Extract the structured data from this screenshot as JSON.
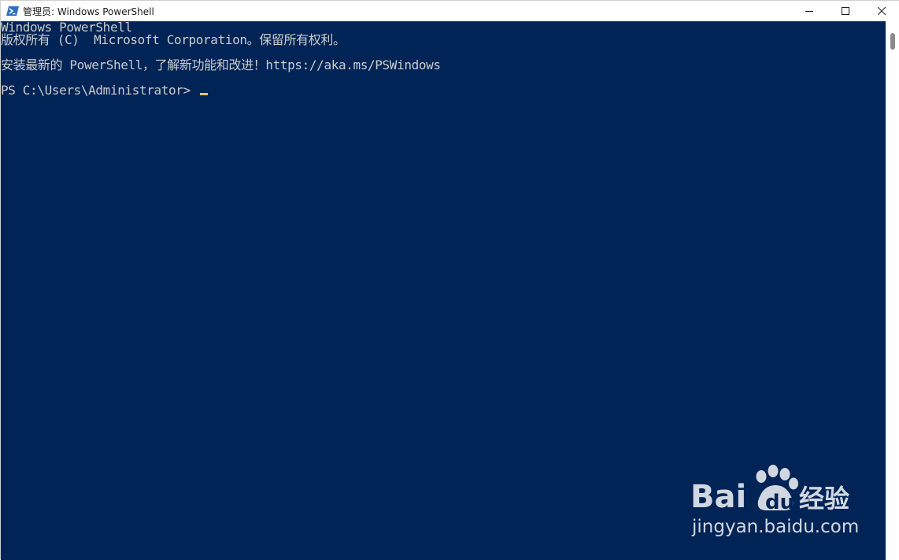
{
  "window": {
    "title": "管理员: Windows PowerShell",
    "app_icon": "powershell-icon",
    "controls": [
      "minimize-icon",
      "maximize-icon",
      "close-icon"
    ]
  },
  "console": {
    "background": "#012456",
    "text_color": "#cccccc",
    "cursor_color": "#f0c470",
    "lines": [
      "Windows PowerShell",
      "版权所有 (C)  Microsoft Corporation。保留所有权利。",
      "",
      "安装最新的 PowerShell，了解新功能和改进！https://aka.ms/PSWindows",
      "",
      "PS C:\\Users\\Administrator> "
    ]
  },
  "watermark": {
    "logo_text": "Bai du 经验",
    "url_text": "jingyan.baidu.com"
  }
}
